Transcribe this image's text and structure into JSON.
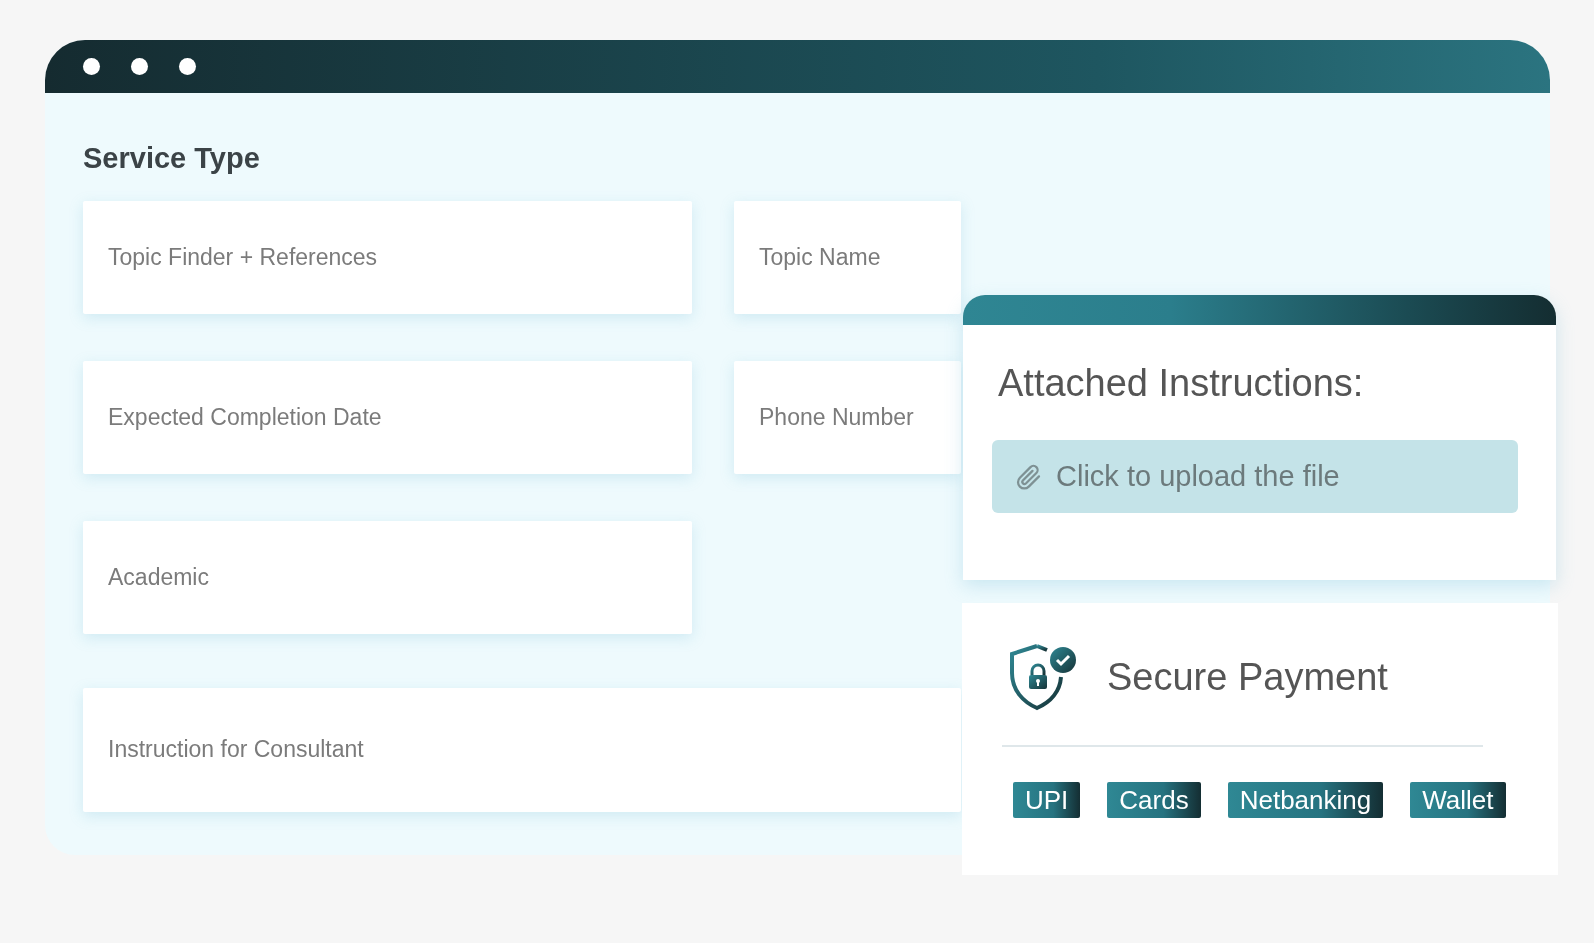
{
  "window": {
    "title": "Service Type"
  },
  "fields": [
    {
      "placeholder": "Topic Finder + References",
      "kind": "half"
    },
    {
      "placeholder": "Topic Name",
      "kind": "narrow"
    },
    {
      "placeholder": "Expected Completion Date",
      "kind": "half"
    },
    {
      "placeholder": "Phone Number",
      "kind": "narrow"
    },
    {
      "placeholder": "Academic",
      "kind": "half"
    },
    {
      "placeholder": "Instruction for Consultant",
      "kind": "wide"
    }
  ],
  "attachments": {
    "title": "Attached Instructions:",
    "upload_label": "Click to upload the file"
  },
  "payment": {
    "title": "Secure Payment",
    "methods": [
      "UPI",
      "Cards",
      "Netbanking",
      "Wallet"
    ]
  }
}
